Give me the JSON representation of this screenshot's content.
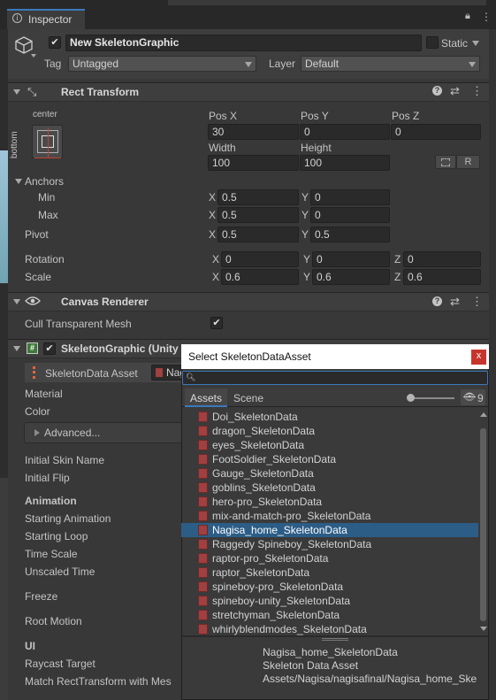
{
  "window": {
    "tab_title": "Inspector"
  },
  "object": {
    "name": "New SkeletonGraphic",
    "static_label": "Static",
    "tag_label": "Tag",
    "tag_value": "Untagged",
    "layer_label": "Layer",
    "layer_value": "Default"
  },
  "rect_transform": {
    "title": "Rect Transform",
    "anchor_h": "center",
    "anchor_v": "bottom",
    "pos_x_label": "Pos X",
    "pos_y_label": "Pos Y",
    "pos_z_label": "Pos Z",
    "pos_x": "30",
    "pos_y": "0",
    "pos_z": "0",
    "width_label": "Width",
    "height_label": "Height",
    "width": "100",
    "height": "100",
    "r_label": "R",
    "anchors_label": "Anchors",
    "min_label": "Min",
    "max_label": "Max",
    "min_x": "0.5",
    "min_y": "0",
    "max_x": "0.5",
    "max_y": "0",
    "pivot_label": "Pivot",
    "pivot_x": "0.5",
    "pivot_y": "0.5",
    "rotation_label": "Rotation",
    "rot_x": "0",
    "rot_y": "0",
    "rot_z": "0",
    "scale_label": "Scale",
    "scale_x": "0.6",
    "scale_y": "0.6",
    "scale_z": "0.6",
    "x": "X",
    "y": "Y",
    "z": "Z"
  },
  "canvas_renderer": {
    "title": "Canvas Renderer",
    "cull_label": "Cull Transparent Mesh",
    "cull_checked": "✔"
  },
  "skeleton_graphic": {
    "title": "SkeletonGraphic (Unity",
    "skeleton_data_label": "SkeletonData Asset",
    "skeleton_data_value": "Nag",
    "material_label": "Material",
    "color_label": "Color",
    "advanced_label": "Advanced...",
    "initial_skin_label": "Initial Skin Name",
    "initial_flip_label": "Initial Flip",
    "animation_header": "Animation",
    "starting_animation_label": "Starting Animation",
    "starting_loop_label": "Starting Loop",
    "time_scale_label": "Time Scale",
    "unscaled_time_label": "Unscaled Time",
    "freeze_label": "Freeze",
    "root_motion_label": "Root Motion",
    "ui_header": "UI",
    "raycast_label": "Raycast Target",
    "match_rect_label": "Match RectTransform with Mes"
  },
  "picker": {
    "title": "Select SkeletonDataAsset",
    "close": "x",
    "search_value": "",
    "tab_assets": "Assets",
    "tab_scene": "Scene",
    "hidden_count": "9",
    "items": [
      "Doi_SkeletonData",
      "dragon_SkeletonData",
      "eyes_SkeletonData",
      "FootSoldier_SkeletonData",
      "Gauge_SkeletonData",
      "goblins_SkeletonData",
      "hero-pro_SkeletonData",
      "mix-and-match-pro_SkeletonData",
      "Nagisa_home_SkeletonData",
      "Raggedy Spineboy_SkeletonData",
      "raptor-pro_SkeletonData",
      "raptor_SkeletonData",
      "spineboy-pro_SkeletonData",
      "spineboy-unity_SkeletonData",
      "stretchyman_SkeletonData",
      "whirlyblendmodes_SkeletonData"
    ],
    "selected_index": 8,
    "info_name": "Nagisa_home_SkeletonData",
    "info_type": "Skeleton Data Asset",
    "info_path": "Assets/Nagisa/nagisafinal/Nagisa_home_Ske"
  },
  "colors": {
    "selection": "#2c5d87",
    "accent": "#3a79bb"
  }
}
